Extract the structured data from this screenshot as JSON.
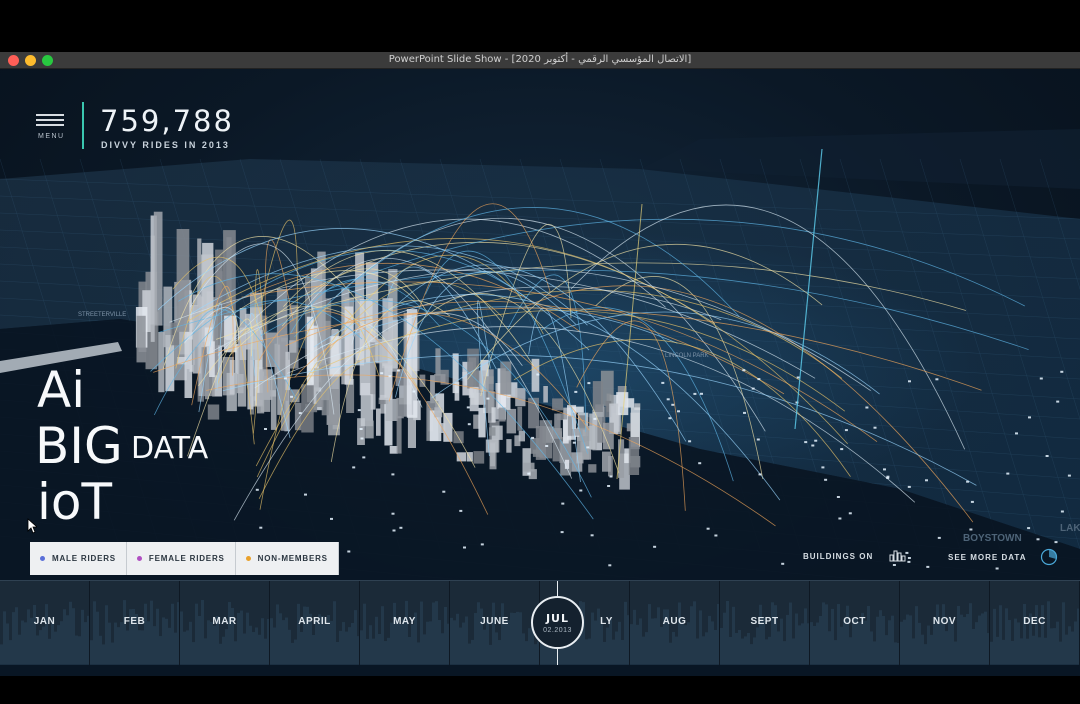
{
  "window": {
    "title": "PowerPoint Slide Show - [2020 الاتصال المؤسسي الرقمي - أكتوبر]"
  },
  "header": {
    "menu_label": "MENU",
    "rides_count": "759,788",
    "rides_caption": "DIVVY RIDES IN 2013"
  },
  "headline": {
    "line1": "Ai",
    "line2": "BIG",
    "line2_suffix": "DATA",
    "line3": "ioT"
  },
  "legend": {
    "items": [
      {
        "label": "MALE RIDERS",
        "color": "#5a6fd8"
      },
      {
        "label": "FEMALE RIDERS",
        "color": "#b04fc2"
      },
      {
        "label": "NON-MEMBERS",
        "color": "#e9a12c"
      }
    ]
  },
  "controls": {
    "buildings_label": "BUILDINGS ON",
    "buildings_icon": "buildings-icon",
    "see_more_label": "SEE MORE DATA",
    "see_more_icon": "pie-chart-icon"
  },
  "map_labels": {
    "streeterville": "STREETERVILLE",
    "lincoln_park": "LINCOLN PARK",
    "boystown": "BOYSTOWN",
    "lake": "LAKE"
  },
  "timeline": {
    "months": [
      "JAN",
      "FEB",
      "MAR",
      "APRIL",
      "MAY",
      "JUNE",
      "JULY",
      "AUG",
      "SEPT",
      "OCT",
      "NOV",
      "DEC"
    ],
    "visible_after_playhead": "LY",
    "current_month": "JUL",
    "current_date": "02.2013"
  },
  "colors": {
    "accent_teal": "#3ac7b0",
    "background": "#0a1522"
  }
}
